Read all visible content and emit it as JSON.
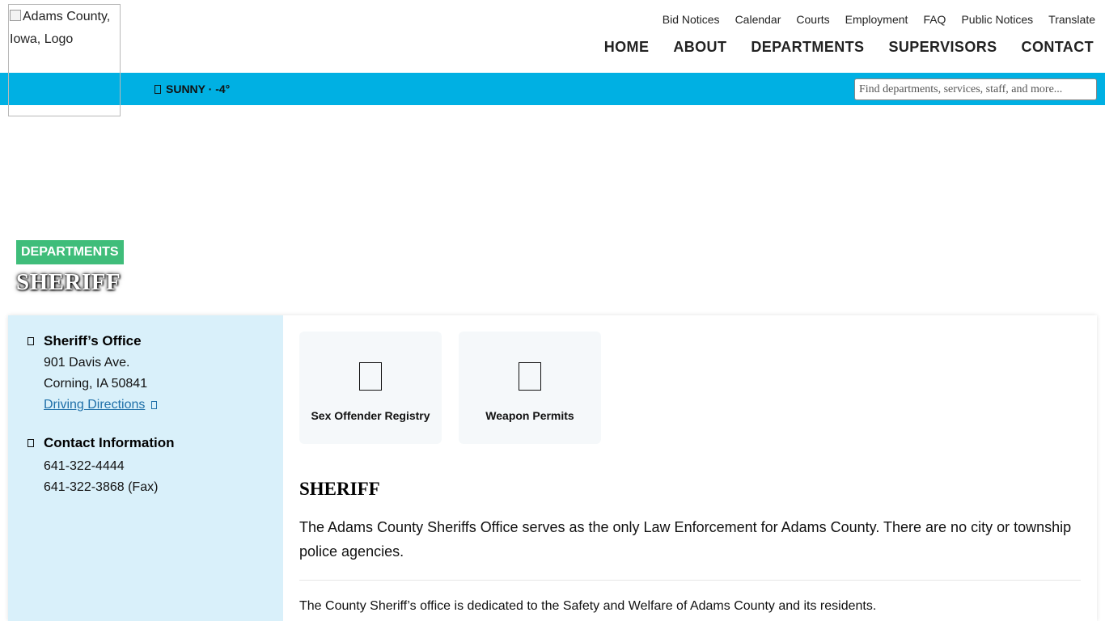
{
  "logo": {
    "alt": "Adams County, Iowa, Logo"
  },
  "utility_nav": [
    "Bid Notices",
    "Calendar",
    "Courts",
    "Employment",
    "FAQ",
    "Public Notices",
    "Translate"
  ],
  "main_nav": [
    "HOME",
    "ABOUT",
    "DEPARTMENTS",
    "SUPERVISORS",
    "CONTACT"
  ],
  "weather": {
    "icon": "sun-icon",
    "text": "SUNNY · -4°"
  },
  "search": {
    "placeholder": "Find departments, services, staff, and more..."
  },
  "colors": {
    "accent_bar": "#00b0e3",
    "tag": "#3fbd7a",
    "sidebar_bg": "#d9f0fa",
    "link": "#1e6fa8"
  },
  "hero": {
    "tag": "DEPARTMENTS",
    "title": "SHERIFF"
  },
  "sidebar": {
    "office": {
      "icon": "location-icon",
      "title": "Sheriff’s Office",
      "address1": "901 Davis Ave.",
      "address2": "Corning, IA 50841",
      "directions": "Driving Directions"
    },
    "contact": {
      "icon": "phone-icon",
      "title": "Contact Information",
      "phone": "641-322-4444",
      "fax": "641-322-3868 (Fax)"
    }
  },
  "tiles": [
    {
      "label": "Sex Offender Registry",
      "icon": "registry-icon"
    },
    {
      "label": "Weapon Permits",
      "icon": "permit-icon"
    }
  ],
  "main": {
    "heading": "SHERIFF",
    "paragraph1": "The Adams County Sheriffs Office serves as the only Law Enforcement for Adams County. There are no city or township police agencies.",
    "paragraph2": "The County Sheriff’s office is dedicated to the Safety and Welfare of Adams County and its residents."
  }
}
